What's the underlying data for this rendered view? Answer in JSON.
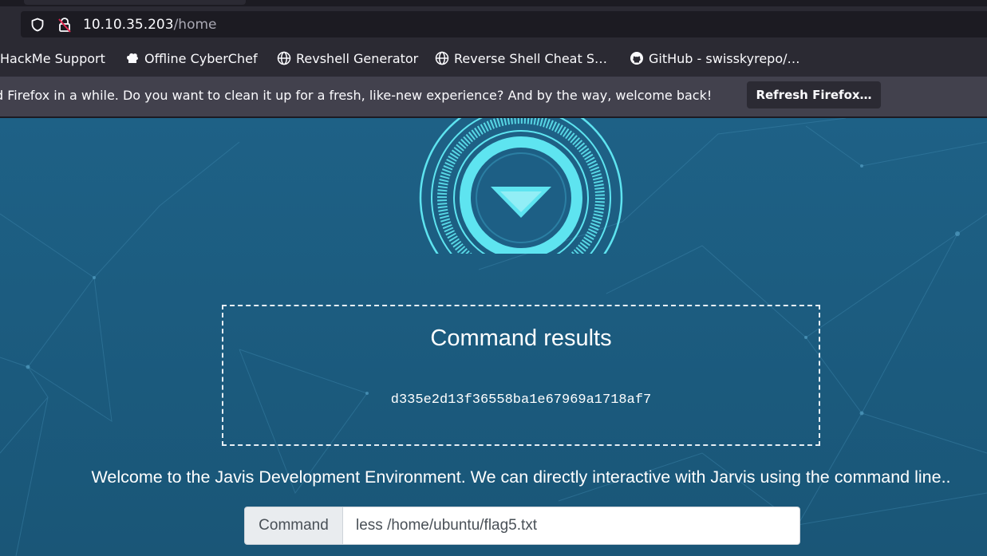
{
  "browser": {
    "url_host": "10.10.35.203",
    "url_path": "/home",
    "bookmarks": [
      {
        "label": "HackMe Support",
        "icon": "tryhackme-icon"
      },
      {
        "label": "Offline CyberChef",
        "icon": "chef-hat-icon"
      },
      {
        "label": "Revshell Generator",
        "icon": "globe-icon"
      },
      {
        "label": "Reverse Shell Cheat S…",
        "icon": "globe-icon"
      },
      {
        "label": "GitHub - swisskyrepo/…",
        "icon": "github-icon"
      }
    ],
    "notification": {
      "text": "d Firefox in a while. Do you want to clean it up for a fresh, like-new experience? And by the way, welcome back!",
      "button_label": "Refresh Firefox…"
    }
  },
  "page": {
    "results_title": "Command results",
    "results_output": "d335e2d13f36558ba1e67969a1718af7",
    "welcome_text": "Welcome to the Javis Development Environment. We can directly interactive with Jarvis using the command line..",
    "command_label": "Command",
    "command_value": "less /home/ubuntu/flag5.txt"
  },
  "colors": {
    "page_bg": "#1d5a7e",
    "logo_accent": "#5ee4f0",
    "chrome_bg": "#2b2a33",
    "notification_bg": "#42414d"
  }
}
